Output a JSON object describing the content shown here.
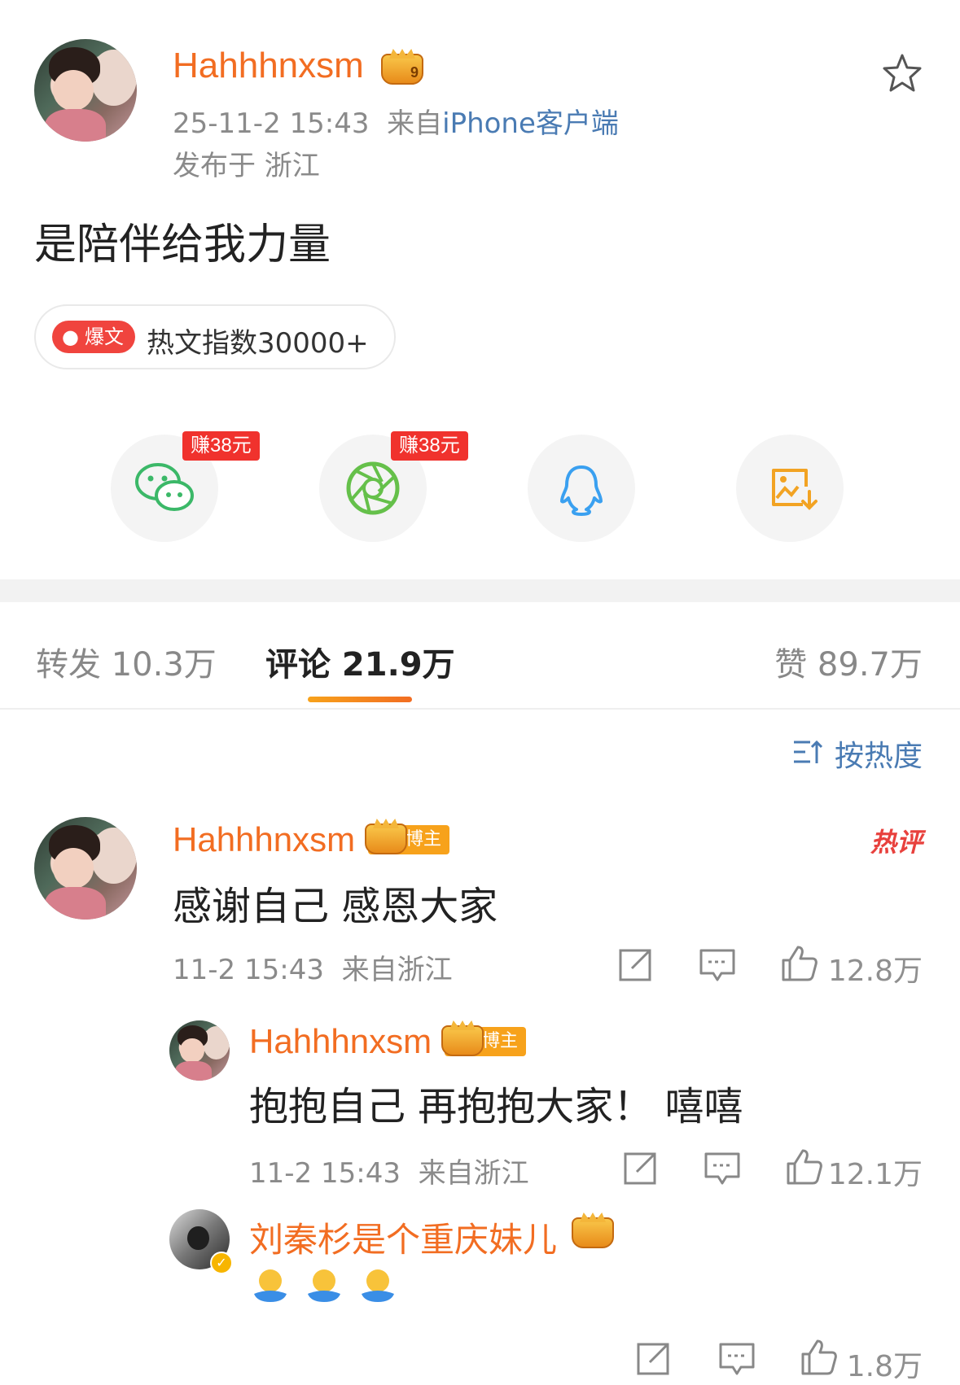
{
  "post": {
    "username": "Hahhhnxsm",
    "vip_level": "9",
    "time": "25-11-2 15:43",
    "source_prefix": "来自",
    "source": "iPhone客户端",
    "location": "发布于 浙江",
    "content": "是陪伴给我力量",
    "hot_tag": "爆文",
    "hot_index": "热文指数30000+"
  },
  "share": {
    "wechat_earn": "赚38元",
    "moments_earn": "赚38元"
  },
  "stats_tabs": {
    "repost": "转发 10.3万",
    "comments": "评论 21.9万",
    "likes": "赞 89.7万"
  },
  "sort": {
    "label": "按热度"
  },
  "comments": [
    {
      "username": "Hahhhnxsm",
      "badge": "博主",
      "hot_label": "热评",
      "text": "感谢自己 感恩大家",
      "meta": "11-2 15:43  来自浙江",
      "likes": "12.8万"
    }
  ],
  "replies": [
    {
      "username": "Hahhhnxsm",
      "badge": "博主",
      "text": "抱抱自己 再抱抱大家！ 嘻嘻",
      "meta": "11-2 15:43  来自浙江",
      "likes": "12.1万"
    },
    {
      "username": "刘秦杉是个重庆妹儿",
      "likes": "1.8万"
    }
  ],
  "colors": {
    "accent_orange": "#f26d22",
    "link_blue": "#4a7bb3",
    "tab_underline": "#f7a21b",
    "earn_red": "#f0322d"
  }
}
